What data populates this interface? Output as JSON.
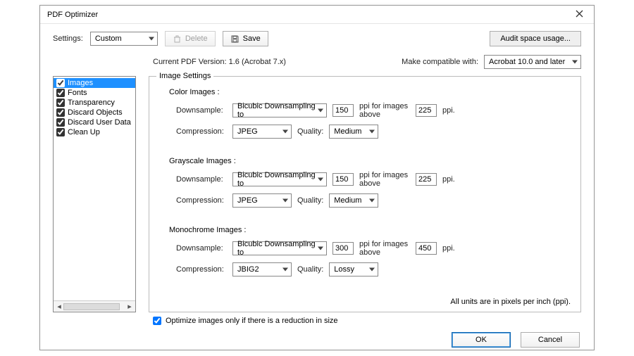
{
  "window": {
    "title": "PDF Optimizer"
  },
  "toolbar": {
    "settings_label": "Settings:",
    "settings_value": "Custom",
    "delete_label": "Delete",
    "save_label": "Save",
    "audit_label": "Audit space usage..."
  },
  "version": {
    "current_label": "Current PDF Version: 1.6 (Acrobat 7.x)",
    "compat_label": "Make compatible with:",
    "compat_value": "Acrobat 10.0 and later"
  },
  "sidebar": {
    "items": [
      {
        "label": "Images",
        "checked": true,
        "selected": true
      },
      {
        "label": "Fonts",
        "checked": true
      },
      {
        "label": "Transparency",
        "checked": true
      },
      {
        "label": "Discard Objects",
        "checked": true
      },
      {
        "label": "Discard User Data",
        "checked": true
      },
      {
        "label": "Clean Up",
        "checked": true
      }
    ]
  },
  "panel": {
    "legend": "Image Settings",
    "labels": {
      "downsample": "Downsample:",
      "compression": "Compression:",
      "quality": "Quality:",
      "ppi_mid": "ppi for images above",
      "ppi_end": "ppi."
    },
    "color": {
      "header": "Color Images :",
      "downsample_method": "Bicubic Downsampling to",
      "downsample_value": "150",
      "above_value": "225",
      "compression": "JPEG",
      "quality": "Medium"
    },
    "gray": {
      "header": "Grayscale Images :",
      "downsample_method": "Bicubic Downsampling to",
      "downsample_value": "150",
      "above_value": "225",
      "compression": "JPEG",
      "quality": "Medium"
    },
    "mono": {
      "header": "Monochrome Images :",
      "downsample_method": "Bicubic Downsampling to",
      "downsample_value": "300",
      "above_value": "450",
      "compression": "JBIG2",
      "quality": "Lossy"
    },
    "note": "All units are in pixels per inch (ppi)."
  },
  "optimize_checkbox": {
    "label": "Optimize images only if there is a reduction in size",
    "checked": true
  },
  "footer": {
    "ok": "OK",
    "cancel": "Cancel"
  }
}
